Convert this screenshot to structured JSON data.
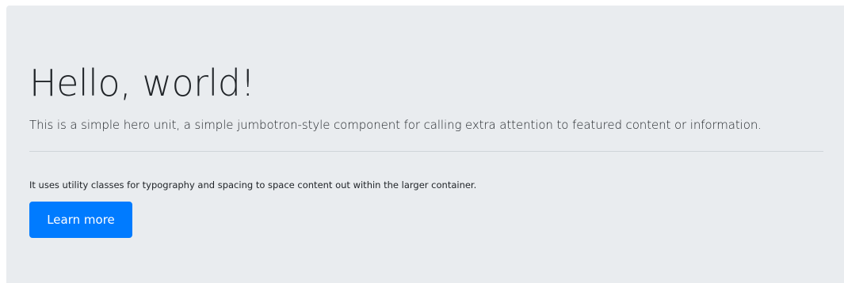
{
  "jumbotron": {
    "heading": "Hello, world!",
    "lead": "This is a simple hero unit, a simple jumbotron-style component for calling extra attention to featured content or information.",
    "body": "It uses utility classes for typography and spacing to space content out within the larger container.",
    "button_label": "Learn more"
  },
  "colors": {
    "background": "#e9ecef",
    "text": "#212529",
    "primary": "#007bff",
    "divider": "#cfd4d9"
  }
}
